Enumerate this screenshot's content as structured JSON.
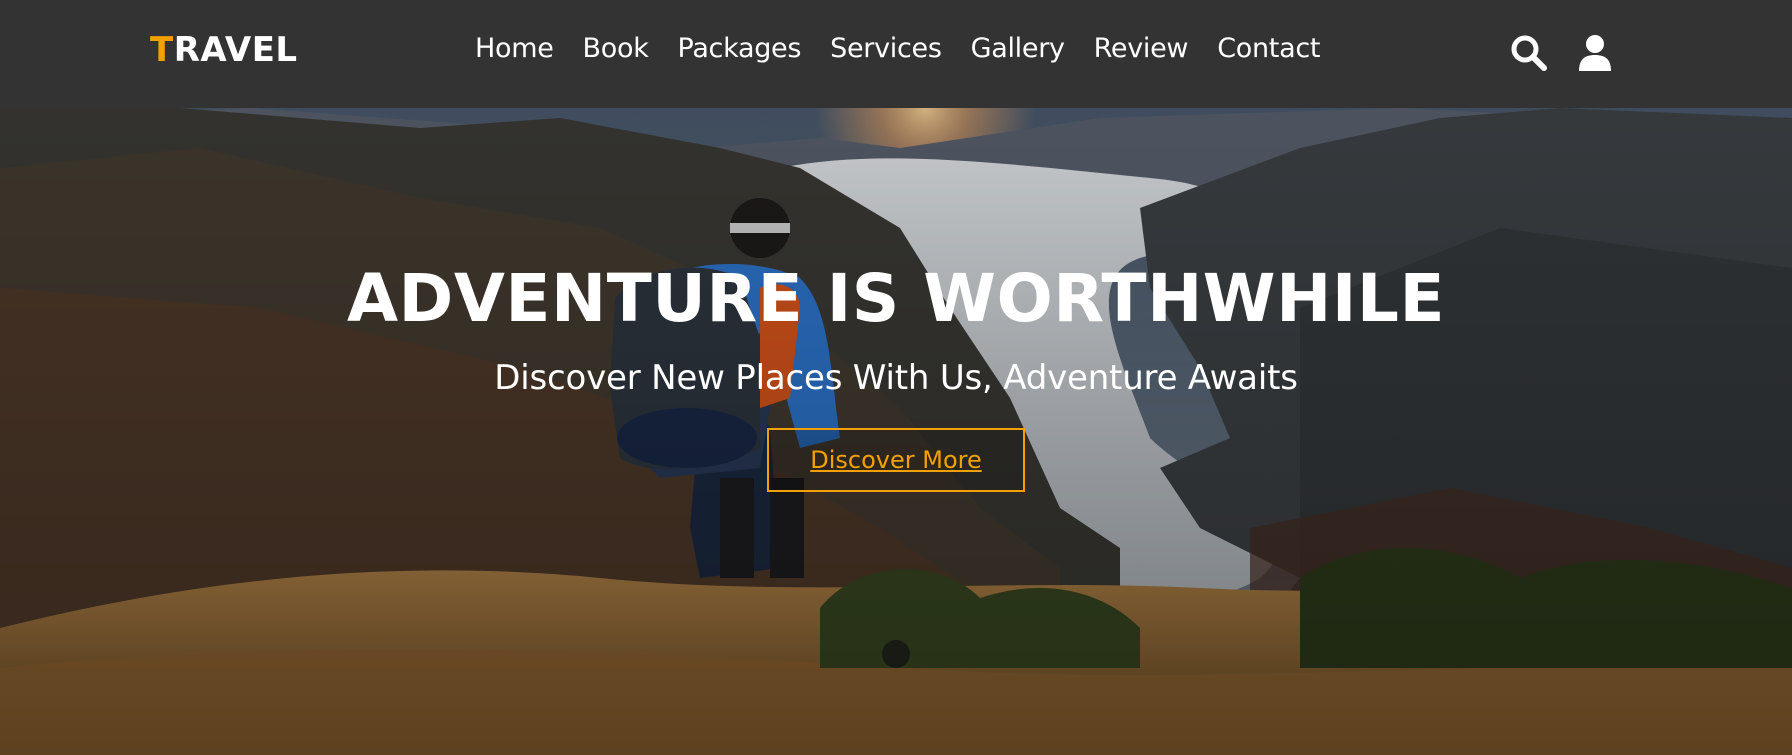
{
  "header": {
    "logo_first": "T",
    "logo_rest": "RAVEL",
    "nav": [
      {
        "label": "Home"
      },
      {
        "label": "Book"
      },
      {
        "label": "Packages"
      },
      {
        "label": "Services"
      },
      {
        "label": "Gallery"
      },
      {
        "label": "Review"
      },
      {
        "label": "Contact"
      }
    ],
    "icons": [
      "search-icon",
      "user-icon"
    ]
  },
  "hero": {
    "title": "ADVENTURE IS WORTHWHILE",
    "subtitle": "Discover New Places With Us, Adventure Awaits",
    "button_label": "Discover More"
  },
  "colors": {
    "header_bg": "#333333",
    "accent": "#f2a100",
    "text": "#ffffff"
  }
}
